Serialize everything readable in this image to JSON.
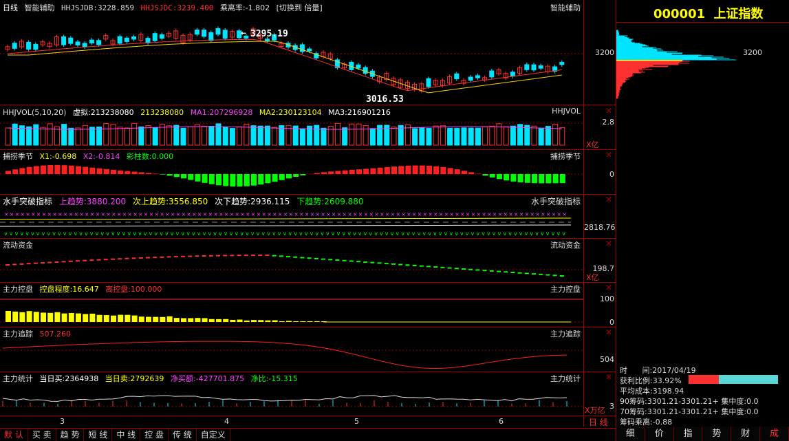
{
  "kline": {
    "period": "日线",
    "indicator": "智能辅助",
    "hhjsjdb": "HHJSJDB:3228.859",
    "hhjsjdc": "HHJSJDC:3239.400",
    "deviation": "乘离率:-1.802",
    "switch_label": "[切换到 倍量]",
    "right_title": "智能辅助",
    "high_label": "3295.19",
    "low_label": "3016.53",
    "axis_3200": "3200"
  },
  "volume": {
    "name": "HHJVOL(5,10,20)",
    "virtual": "虚拟:213238080",
    "value": "213238080",
    "ma1": "MA1:207296928",
    "ma2": "MA2:230123104",
    "ma3": "MA3:216901216",
    "right_title": "HHJVOL",
    "axis_value": "2.8",
    "unit": "X亿"
  },
  "season": {
    "name": "捕捞季节",
    "x1": "X1:-0.698",
    "x2": "X2:-0.814",
    "bars": "彩柱数:0.000",
    "right_title": "捕捞季节",
    "axis_zero": "0"
  },
  "sailor": {
    "name": "水手突破指标",
    "up": "上趋势:3880.200",
    "sub_up": "次上趋势:3556.850",
    "sub_down": "次下趋势:2936.115",
    "down": "下趋势:2609.880",
    "right_title": "水手突破指标",
    "axis_value": "2818.76"
  },
  "liquidity": {
    "name": "流动资金",
    "right_title": "流动资金",
    "axis_value": "198.7",
    "unit": "X亿"
  },
  "control": {
    "name": "主力控盘",
    "degree": "控盘程度:16.647",
    "high": "高控盘:100.000",
    "right_title": "主力控盘",
    "axis_100": "100",
    "axis_0": "0"
  },
  "tracking": {
    "name": "主力追踪",
    "value": "507.260",
    "right_title": "主力追踪",
    "axis_value": "504"
  },
  "stats": {
    "name": "主力统计",
    "buy": "当日买:2364938",
    "sell": "当日卖:2792639",
    "net": "净买额:-427701.875",
    "ratio": "净比:-15.315",
    "right_title": "主力统计",
    "axis_value": "3",
    "unit": "X万亿"
  },
  "months": [
    "3",
    "4",
    "5",
    "6"
  ],
  "period_label": "日 线",
  "tabs": [
    "默 认",
    "买 卖",
    "趋 势",
    "短 线",
    "中 线",
    "控 盘",
    "传 统",
    "自定义"
  ],
  "right_panel": {
    "code": "000001",
    "name": "上证指数",
    "axis_3200": "3200",
    "time_label": "时",
    "time_value": "间:2017/04/19",
    "profit_ratio": "获利比例:33.92%",
    "avg_cost": "平均成本:3198.94",
    "chip90": "90筹码:3301.21-3301.21+ 集中度:0.0",
    "chip70": "70筹码:3301.21-3301.21+ 集中度:0.0",
    "chip_dev": "筹码乘离:-0.88",
    "tabs": [
      "细",
      "价",
      "指",
      "势",
      "财",
      "成"
    ]
  },
  "colors": {
    "up": "#ff3030",
    "down": "#00e5ff",
    "frame": "#a00000",
    "yellow": "#ffff00",
    "magenta": "#ff40ff",
    "green": "#00ff00"
  }
}
